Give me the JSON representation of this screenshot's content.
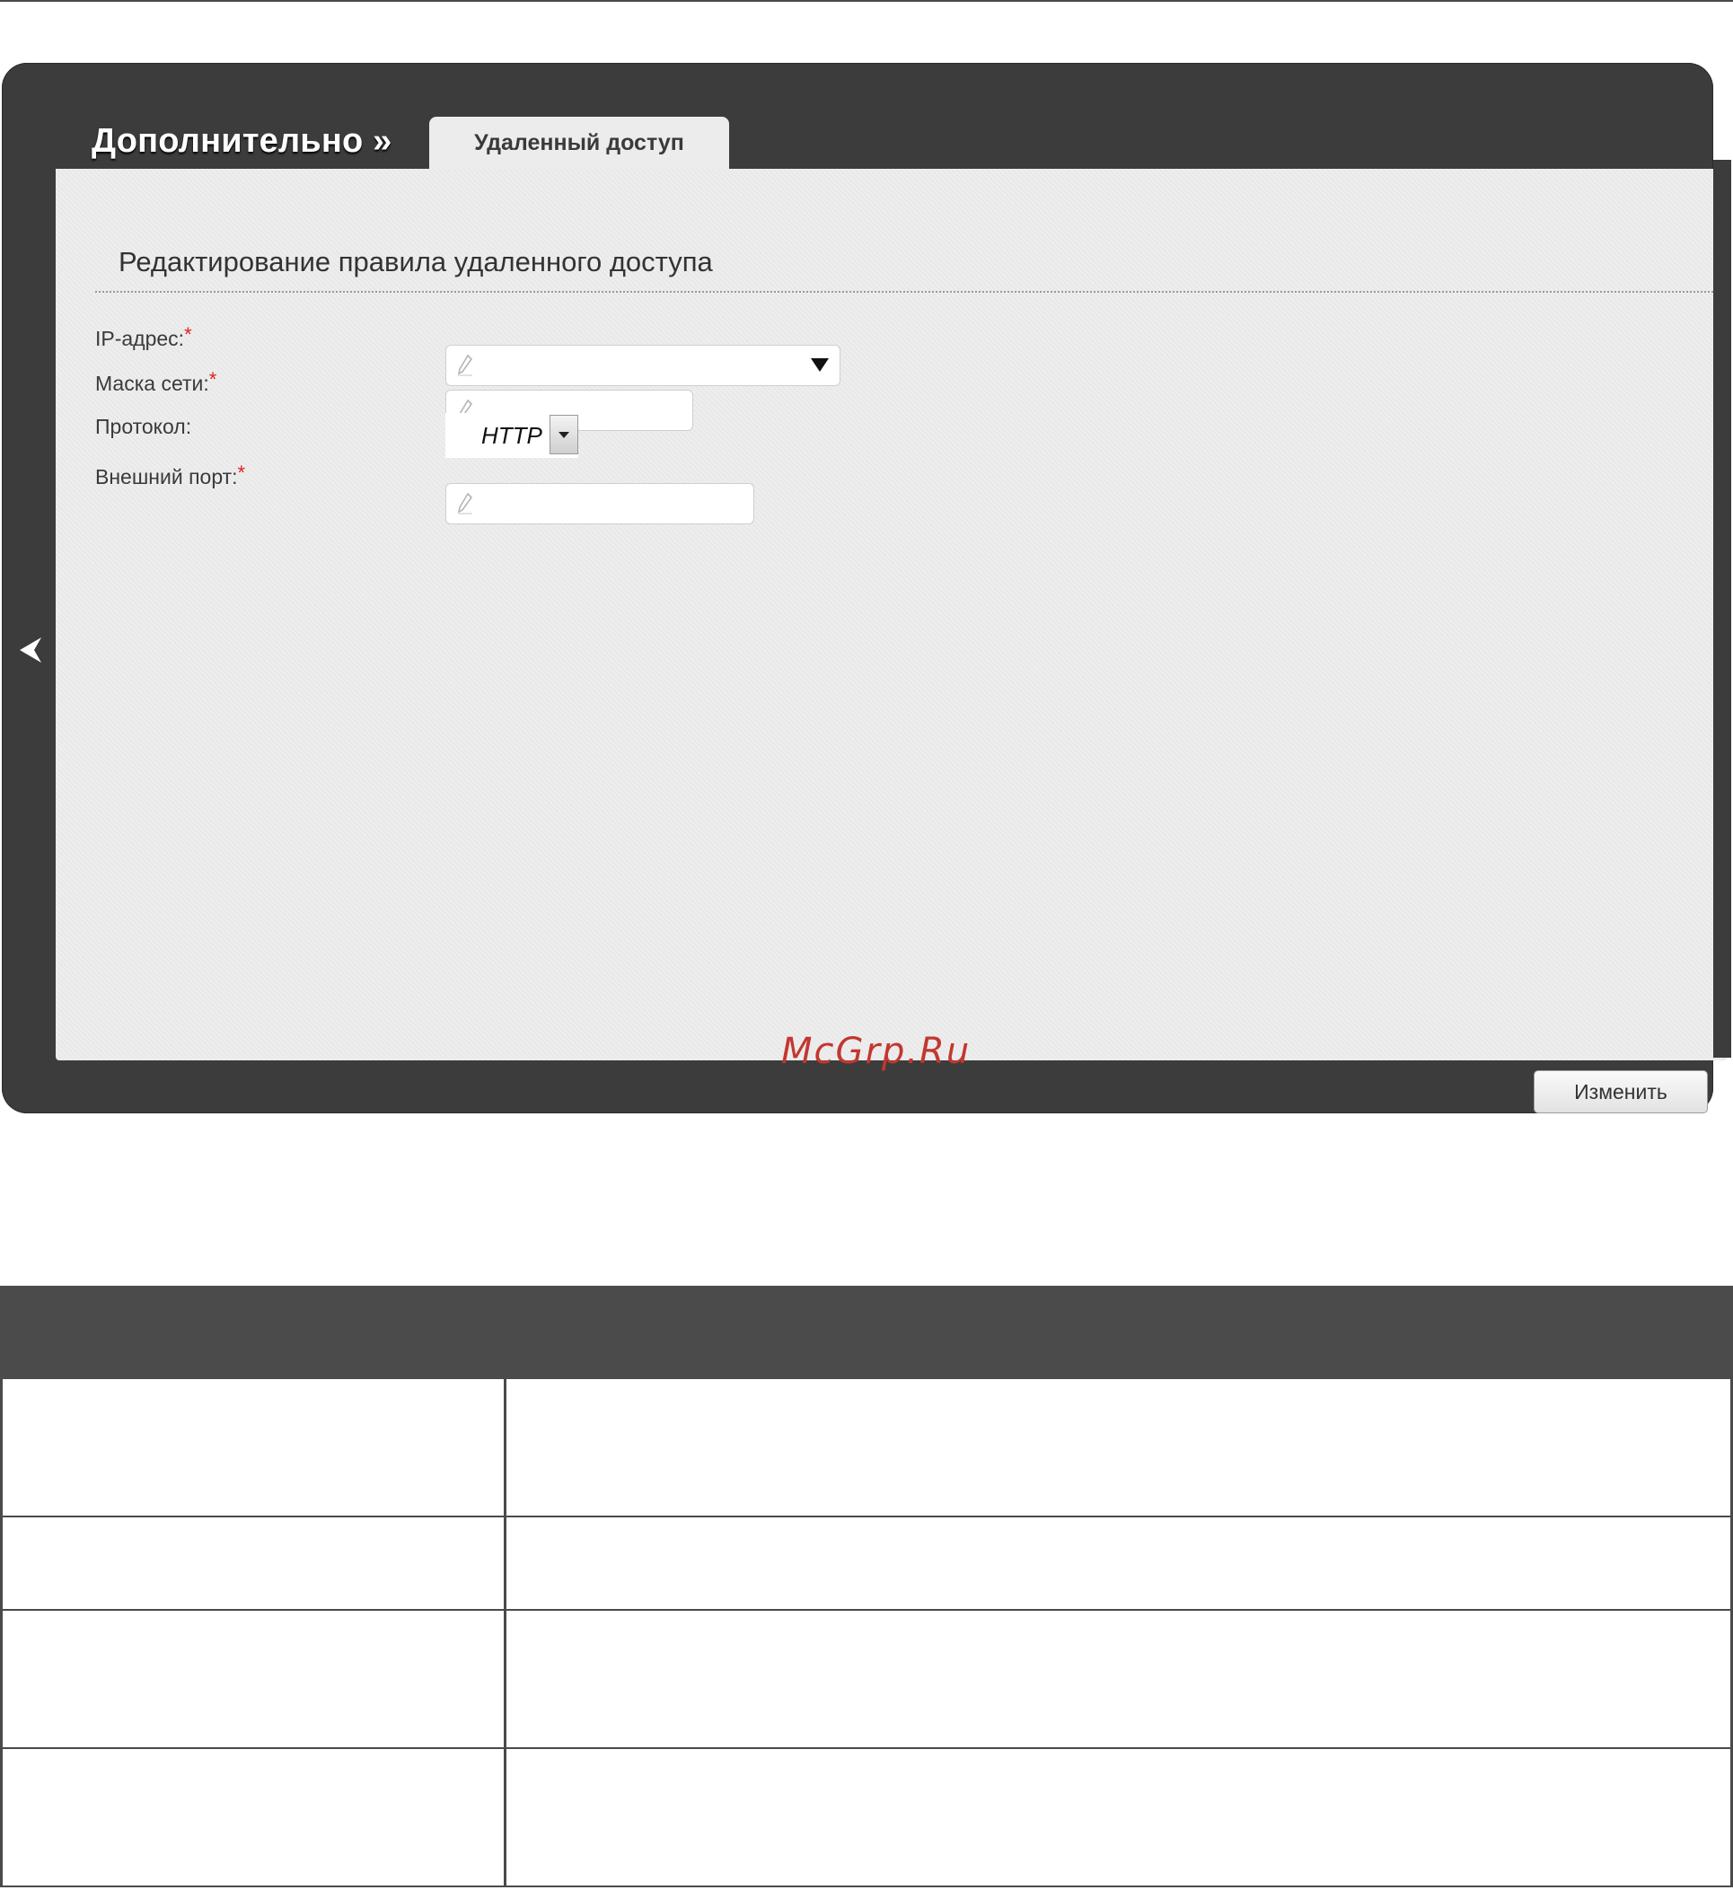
{
  "header": {
    "section_title": "Дополнительно »",
    "active_tab": "Удаленный доступ"
  },
  "form": {
    "title": "Редактирование правила удаленного доступа",
    "fields": [
      {
        "label": "IP-адрес:",
        "required": "*",
        "value": "",
        "type": "combo"
      },
      {
        "label": "Маска сети:",
        "required": "*",
        "value": "",
        "type": "text"
      },
      {
        "label": "Протокол:",
        "required": "",
        "value": "HTTP",
        "type": "select"
      },
      {
        "label": "Внешний порт:",
        "required": "*",
        "value": "",
        "type": "text"
      }
    ],
    "submit_label": "Изменить"
  },
  "watermark": "McGrp.Ru",
  "icons": {
    "back": "chevron-left-icon",
    "edit": "pencil-icon",
    "dropdown": "triangle-down-icon"
  },
  "colors": {
    "shell": "#3c3c3c",
    "panel": "#ececec",
    "required": "#e0201e",
    "watermark": "#c2372f",
    "table_header": "#4b4b4b"
  },
  "table": {
    "header": "",
    "rows": [
      {
        "name": "",
        "description": ""
      },
      {
        "name": "",
        "description": ""
      },
      {
        "name": "",
        "description": ""
      },
      {
        "name": "",
        "description": ""
      }
    ]
  }
}
